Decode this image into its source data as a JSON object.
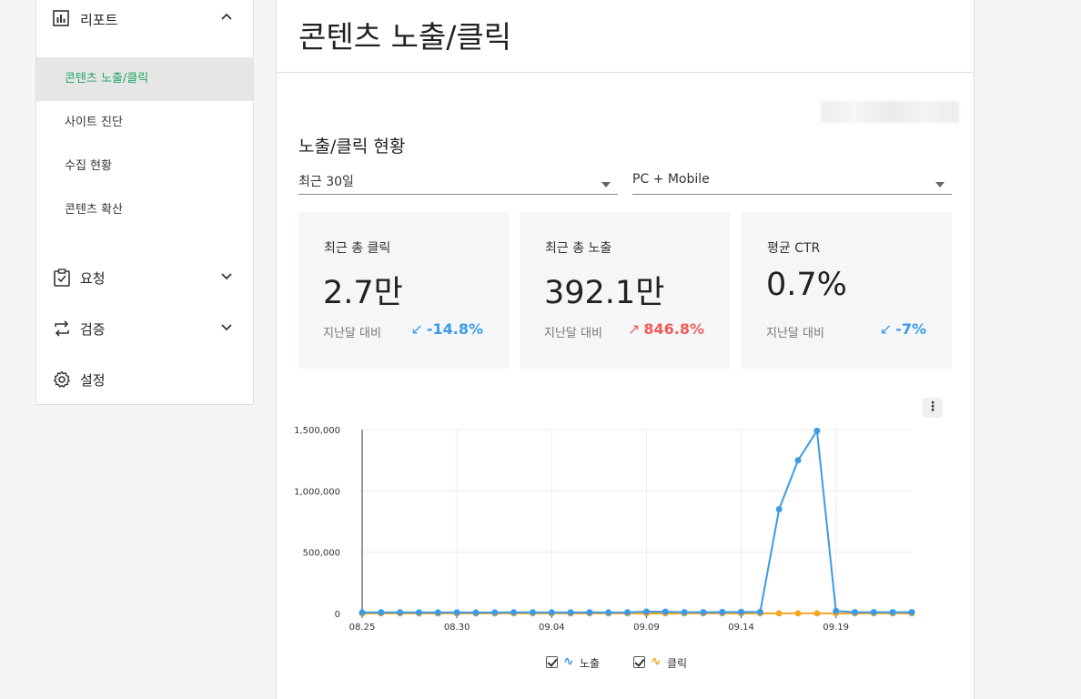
{
  "sidebar": {
    "report_label": "리포트",
    "report_items": [
      {
        "label": "콘텐츠 노출/클릭"
      },
      {
        "label": "사이트 진단"
      },
      {
        "label": "수집 현황"
      },
      {
        "label": "콘텐츠 확산"
      }
    ],
    "groups": [
      {
        "label": "요청"
      },
      {
        "label": "검증"
      },
      {
        "label": "설정"
      }
    ]
  },
  "main": {
    "page_title": "콘텐츠 노출/클릭",
    "section_title": "노출/클릭 현황",
    "period_select": "최근 30일",
    "device_select": "PC + Mobile",
    "cards": [
      {
        "label": "최근 총 클릭",
        "value": "2.7만",
        "compare_label": "지난달 대비",
        "delta": "-14.8%",
        "arrow": "↙"
      },
      {
        "label": "최근 총 노출",
        "value": "392.1만",
        "compare_label": "지난달 대비",
        "delta": "846.8%",
        "arrow": "↗"
      },
      {
        "label": "평균 CTR",
        "value": "0.7%",
        "compare_label": "지난달 대비",
        "delta": "-7%",
        "arrow": "↙"
      }
    ],
    "menu_glyph": "⋮"
  },
  "legend": {
    "impressions": "노출",
    "clicks": "클릭",
    "symbol": "∿"
  },
  "colors": {
    "impressions": "#3b9be8",
    "clicks": "#f5a623",
    "accent_green": "#20a660",
    "up_red": "#f25b5b"
  },
  "chart_data": {
    "type": "line",
    "x": [
      "08.25",
      "08.26",
      "08.27",
      "08.28",
      "08.29",
      "08.30",
      "08.31",
      "09.01",
      "09.02",
      "09.03",
      "09.04",
      "09.05",
      "09.06",
      "09.07",
      "09.08",
      "09.09",
      "09.10",
      "09.11",
      "09.12",
      "09.13",
      "09.14",
      "09.15",
      "09.16",
      "09.17",
      "09.18",
      "09.19",
      "09.20",
      "09.21",
      "09.22",
      "09.23"
    ],
    "x_ticks": [
      "08.25",
      "08.30",
      "09.04",
      "09.09",
      "09.14",
      "09.19"
    ],
    "y_ticks": [
      "0",
      "500,000",
      "1,000,000",
      "1,500,000"
    ],
    "ylim": [
      0,
      1500000
    ],
    "series": [
      {
        "name": "노출",
        "values": [
          8000,
          9000,
          9000,
          8500,
          8000,
          8500,
          7000,
          8000,
          9000,
          9000,
          8000,
          8500,
          9000,
          8000,
          9000,
          15000,
          14000,
          10000,
          10000,
          11000,
          12000,
          12000,
          850000,
          1250000,
          1490000,
          20000,
          10000,
          10000,
          10000,
          10000
        ]
      },
      {
        "name": "클릭",
        "values": [
          200,
          300,
          300,
          250,
          250,
          250,
          200,
          250,
          300,
          300,
          250,
          250,
          300,
          250,
          300,
          400,
          350,
          300,
          300,
          300,
          300,
          300,
          500,
          500,
          500,
          300,
          300,
          300,
          300,
          300
        ]
      }
    ],
    "grid": true
  }
}
